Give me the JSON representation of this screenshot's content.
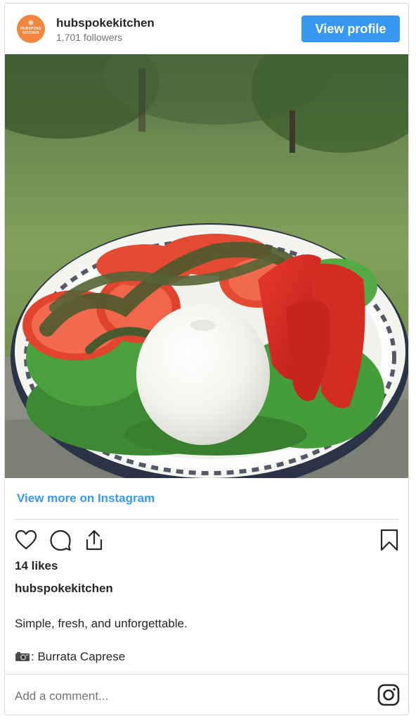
{
  "header": {
    "avatar_line1": "❋",
    "avatar_line2": "HUBSPOKE",
    "avatar_line3": "KITCHEN",
    "username": "hubspokekitchen",
    "followers": "1,701 followers",
    "view_profile_label": "View profile"
  },
  "post": {
    "image_icon": "burrata-caprese-photo",
    "view_more_label": "View more on Instagram",
    "likes": "14 likes",
    "caption_user": "hubspokekitchen",
    "caption_text": "Simple, fresh, and unforgettable.",
    "caption_line2": ": Burrata Caprese",
    "camera_icon": "camera-icon"
  },
  "actions": {
    "like_icon": "heart-icon",
    "comment_icon": "comment-icon",
    "share_icon": "share-icon",
    "save_icon": "bookmark-icon"
  },
  "comment": {
    "placeholder": "Add a comment...",
    "instagram_icon": "instagram-icon"
  },
  "colors": {
    "accent": "#3897f0",
    "avatar": "#f2853f",
    "border": "#dbdbdb"
  }
}
